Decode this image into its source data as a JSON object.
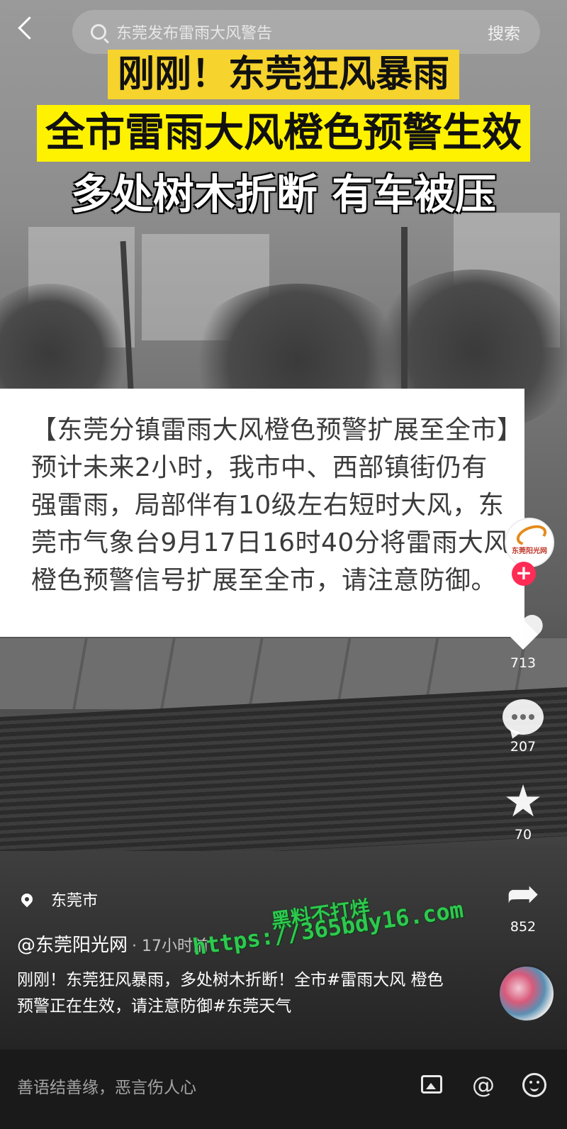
{
  "search": {
    "query": "东莞发布雷雨大风警告",
    "button_label": "搜索"
  },
  "headline": {
    "line1": "刚刚！东莞狂风暴雨",
    "line2": "全市雷雨大风橙色预警生效",
    "line3": "多处树木折断 有车被压"
  },
  "card": {
    "text": "【东莞分镇雷雨大风橙色预警扩展至全市】预计未来2小时，我市中、西部镇街仍有强雷雨，局部伴有10级左右短时大风，东莞市气象台9月17日16时40分将雷雨大风橙色预警信号扩展至全市，请注意防御。"
  },
  "brand": {
    "name": "东莞阳光网"
  },
  "actions": {
    "likes": "713",
    "comments": "207",
    "favorites": "70",
    "shares": "852",
    "follow": "+"
  },
  "post": {
    "location": "东莞市",
    "author": "@东莞阳光网",
    "time": "· 17小时前",
    "caption": "刚刚！东莞狂风暴雨，多处树木折断！全市#雷雨大风 橙色预警正在生效，请注意防御#东莞天气"
  },
  "watermark": {
    "line1": "黑料不打烊",
    "line2": "https://365bdy16.com"
  },
  "comment_bar": {
    "placeholder": "善语结善缘，恶言伤人心",
    "at_symbol": "@"
  },
  "icons": [
    "back-icon",
    "search-icon",
    "heart-icon",
    "comment-icon",
    "star-icon",
    "share-icon",
    "location-pin-icon",
    "image-icon",
    "at-icon",
    "emoji-icon"
  ]
}
